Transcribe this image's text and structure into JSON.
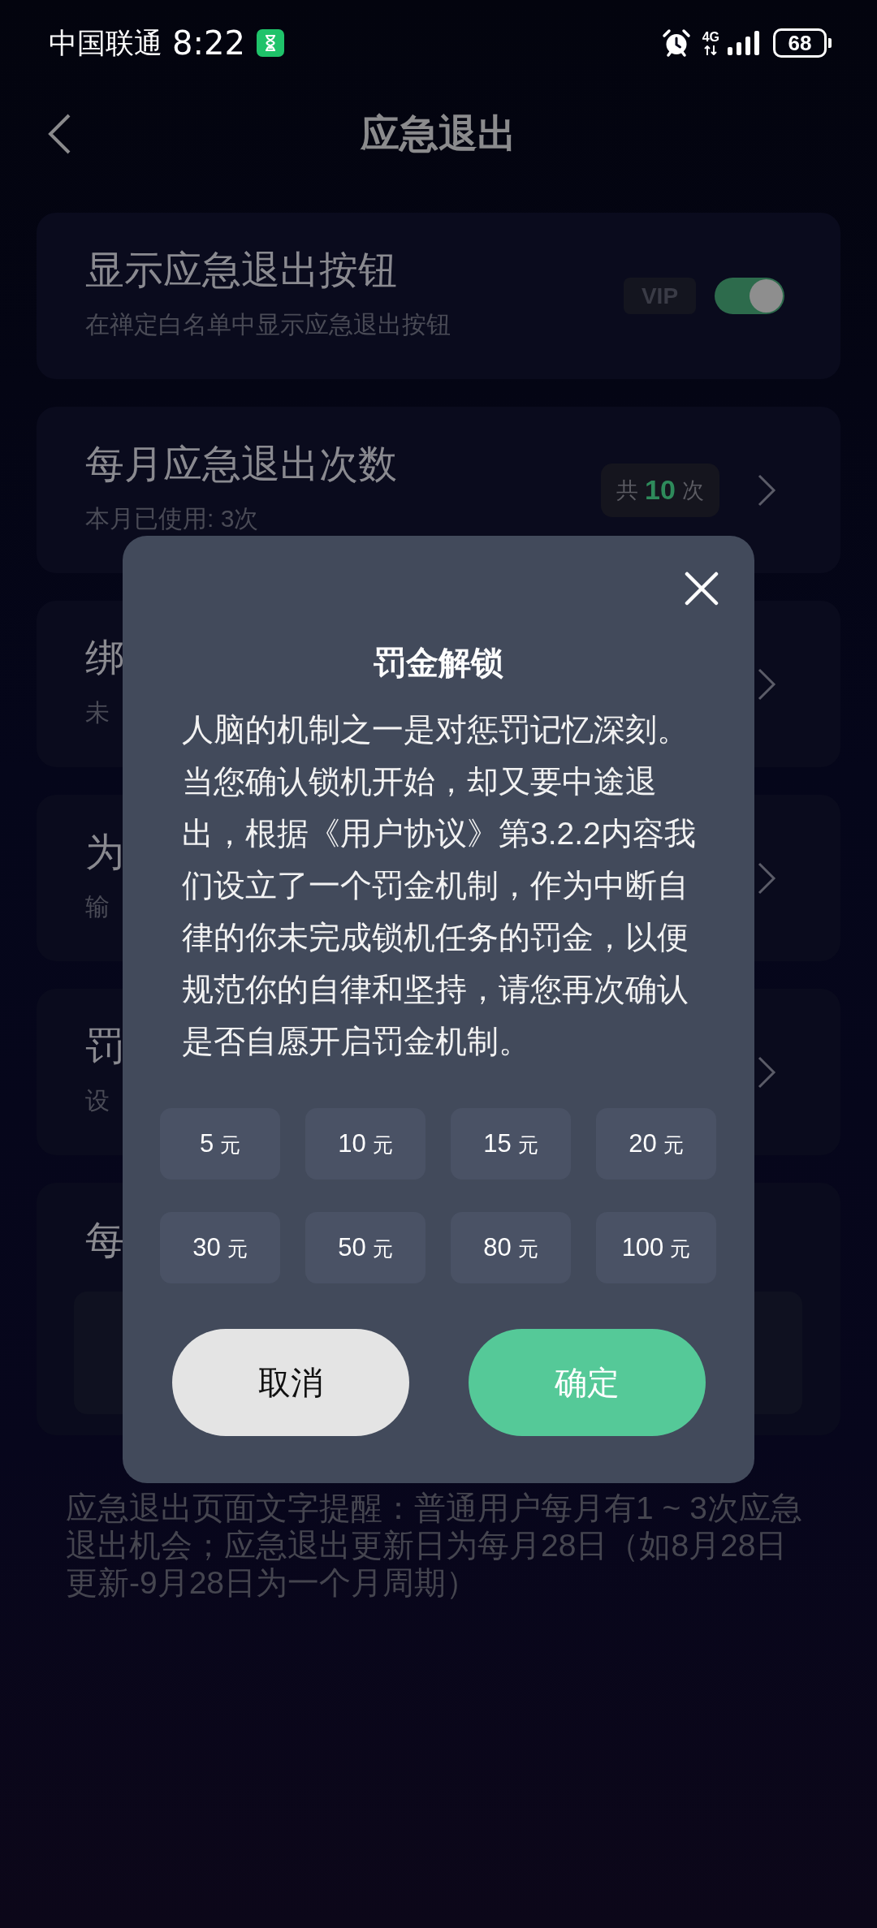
{
  "status_bar": {
    "carrier": "中国联通",
    "time": "8:22",
    "network": "4G",
    "battery": "68"
  },
  "header": {
    "title": "应急退出"
  },
  "settings": [
    {
      "kind": "toggle",
      "title": "显示应急退出按钮",
      "subtitle": "在禅定白名单中显示应急退出按钮",
      "badge": "VIP",
      "on": true
    },
    {
      "kind": "count",
      "title": "每月应急退出次数",
      "subtitle": "本月已使用: 3次",
      "badge": {
        "prefix": "共",
        "value": "10",
        "suffix": "次"
      }
    },
    {
      "kind": "link",
      "title": "绑",
      "subtitle": "未"
    },
    {
      "kind": "link",
      "title": "为",
      "subtitle": "输"
    },
    {
      "kind": "link",
      "title": "罚",
      "subtitle": "设"
    },
    {
      "kind": "text",
      "title": "每"
    }
  ],
  "footnote": "应急退出页面文字提醒：普通用户每月有1 ~ 3次应急退出机会；应急退出更新日为每月28日（如8月28日更新-9月28日为一个月周期）",
  "dialog": {
    "title": "罚金解锁",
    "message": "人脑的机制之一是对惩罚记忆深刻。当您确认锁机开始，却又要中途退出，根据《用户协议》第3.2.2内容我们设立了一个罚金机制，作为中断自律的你未完成锁机任务的罚金，以便规范你的自律和坚持，请您再次确认是否自愿开启罚金机制。",
    "amounts": [
      {
        "amount": "5",
        "unit": "元",
        "selected": false
      },
      {
        "amount": "10",
        "unit": "元",
        "selected": false
      },
      {
        "amount": "15",
        "unit": "元",
        "selected": false
      },
      {
        "amount": "20",
        "unit": "元",
        "selected": false
      },
      {
        "amount": "30",
        "unit": "元",
        "selected": false
      },
      {
        "amount": "50",
        "unit": "元",
        "selected": false
      },
      {
        "amount": "80",
        "unit": "元",
        "selected": false
      },
      {
        "amount": "100",
        "unit": "元",
        "selected": false
      }
    ],
    "buttons": [
      {
        "kind": "cancel",
        "label": "取消"
      },
      {
        "kind": "confirm",
        "label": "确定"
      }
    ]
  }
}
